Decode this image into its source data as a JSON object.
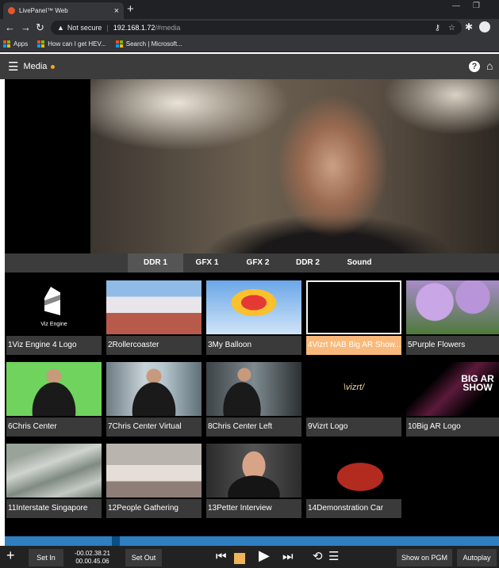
{
  "browser": {
    "tab_title": "LivePanel™ Web",
    "tab_close": "×",
    "new_tab": "+",
    "security": "Not secure",
    "url_host": "192.168.1.72",
    "url_path": "/#media",
    "bookmarks": [
      "Apps",
      "How can I get HEV...",
      "Search | Microsoft..."
    ]
  },
  "app": {
    "title": "Media",
    "help": "?",
    "home": "⌂"
  },
  "media_tabs": [
    "DDR 1",
    "GFX 1",
    "GFX 2",
    "DDR 2",
    "Sound"
  ],
  "active_tab": "DDR 1",
  "clips": [
    {
      "label": "1Viz Engine 4 Logo",
      "thumb_text": "Viz Engine"
    },
    {
      "label": "2Rollercoaster"
    },
    {
      "label": "3My Balloon"
    },
    {
      "label": "4Vizrt NAB Big AR Show...",
      "selected": true
    },
    {
      "label": "5Purple Flowers"
    },
    {
      "label": "6Chris Center"
    },
    {
      "label": "7Chris Center Virtual"
    },
    {
      "label": "8Chris Center Left"
    },
    {
      "label": "9Vizrt Logo",
      "thumb_text": "\\vizrt/"
    },
    {
      "label": "10Big AR Logo",
      "thumb_text": "BIG AR SHOW"
    },
    {
      "label": "11Interstate Singapore"
    },
    {
      "label": "12People Gathering"
    },
    {
      "label": "13Petter Interview"
    },
    {
      "label": "14Demonstration Car"
    }
  ],
  "controls": {
    "set_in": "Set In",
    "timecode_1": "-00.02.38.21",
    "timecode_2": "00.00.45.06",
    "set_out": "Set Out",
    "show_on_pgm": "Show on PGM",
    "autoplay": "Autoplay"
  },
  "colors": {
    "selected_clip": "#f9b97a",
    "timeline": "#2f7fc1",
    "stop_button": "#f0b45a",
    "status_dot": "#f5a623"
  }
}
